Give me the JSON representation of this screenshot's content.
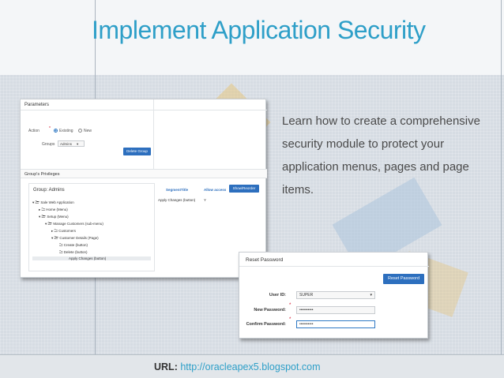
{
  "slide": {
    "title": "Implement Application Security",
    "description": "Learn how to create a comprehensive security module to protect your application menus, pages and page items.",
    "footer_label": "URL:",
    "footer_url": "http://oracleapex5.blogspot.com"
  },
  "parameters_panel": {
    "title": "Parameters",
    "action_label": "Action",
    "action_options": [
      "Existing",
      "New"
    ],
    "action_selected": "Existing",
    "groups_label": "Groups",
    "groups_value": "Admins",
    "delete_button": "Delete Group",
    "privileges_title": "Group's Privileges",
    "tree_title": "Group: Admins",
    "tree_items": [
      "Sale Web Application",
      "Home (Menu)",
      "Setup (Menu)",
      "Manage Customers (sub-menu)",
      "Customers",
      "Customer Details (Page)",
      "Create (button)",
      "Delete (button)",
      "Apply Changes (button)"
    ],
    "grid_headers": [
      "SegmentTitle",
      "Allow access"
    ],
    "grid_button": "Show/Reorder",
    "grid_rows": [
      [
        "Apply Changes (button)",
        "Y"
      ]
    ]
  },
  "reset_panel": {
    "title": "Reset Password",
    "reset_button": "Reset Password",
    "user_id_label": "User ID:",
    "user_id_value": "SUPER",
    "new_password_label": "New Password:",
    "new_password_value": "••••••••••",
    "confirm_password_label": "Confirm Password:",
    "confirm_password_value": "••••••••••"
  },
  "colors": {
    "title": "#2e9fc8",
    "button": "#2d6fbe",
    "required": "#d0021b"
  }
}
